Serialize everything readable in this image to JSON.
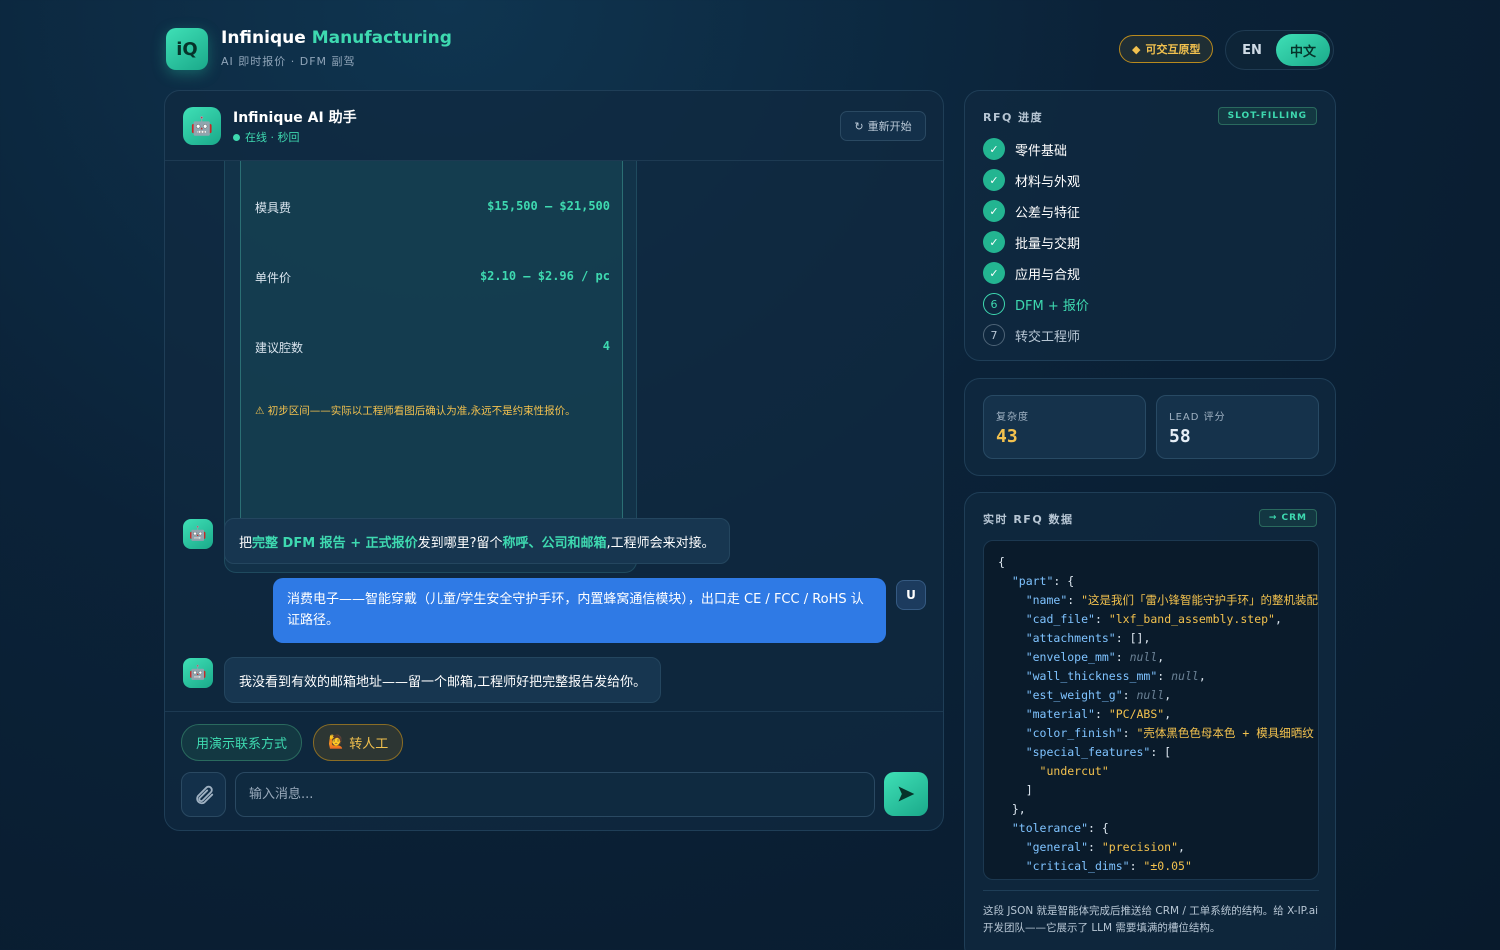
{
  "header": {
    "logo_text": "iQ",
    "brand_name": "Infinique",
    "brand_accent": "Manufacturing",
    "tagline": "AI 即时报价 · DFM 副驾",
    "prototype_badge": "可交互原型",
    "lang_en": "EN",
    "lang_zh": "中文"
  },
  "chat": {
    "title": "Infinique AI 助手",
    "status": "在线 · 秒回",
    "restart_label": "重新开始",
    "quote_card": {
      "rows": [
        {
          "label": "模具费",
          "value": "$15,500 – $21,500"
        },
        {
          "label": "单件价",
          "value": "$2.10 – $2.96 / pc"
        },
        {
          "label": "建议腔数",
          "value": "4"
        }
      ],
      "note": "⚠ 初步区间——实际以工程师看图后确认为准,永远不是约束性报价。"
    },
    "messages": {
      "bot1_a": "把",
      "bot1_b": "完整 DFM 报告 + 正式报价",
      "bot1_c": "发到哪里?留个",
      "bot1_d": "称呼、公司和邮箱",
      "bot1_e": ",工程师会来对接。",
      "user1": "消费电子——智能穿戴（儿童/学生安全守护手环，内置蜂窝通信模块），出口走 CE / FCC / RoHS 认证路径。",
      "user_avatar": "U",
      "bot2": "我没看到有效的邮箱地址——留一个邮箱,工程师好把完整报告发给你。"
    },
    "quick_replies": {
      "demo_contact": "用演示联系方式",
      "human": "转人工"
    },
    "input_placeholder": "输入消息..."
  },
  "rfq_progress": {
    "title": "RFQ 进度",
    "tag": "SLOT-FILLING",
    "steps": [
      {
        "num": "1",
        "label": "零件基础",
        "state": "done"
      },
      {
        "num": "2",
        "label": "材料与外观",
        "state": "done"
      },
      {
        "num": "3",
        "label": "公差与特征",
        "state": "done"
      },
      {
        "num": "4",
        "label": "批量与交期",
        "state": "done"
      },
      {
        "num": "5",
        "label": "应用与合规",
        "state": "done"
      },
      {
        "num": "6",
        "label": "DFM + 报价",
        "state": "active"
      },
      {
        "num": "7",
        "label": "转交工程师",
        "state": "todo"
      }
    ]
  },
  "metrics": {
    "complexity_label": "复杂度",
    "complexity_value": "43",
    "lead_label": "LEAD 评分",
    "lead_value": "58",
    "complexity_color": "#f2c14e",
    "lead_color": "#e6eef6"
  },
  "rfq_data": {
    "title": "实时 RFQ 数据",
    "tag": "→ CRM",
    "json_lines": {
      "l1": "{",
      "l2_k": "\"part\"",
      "l3_k": "\"name\"",
      "l3_v": "\"这是我们「雷小锋智能守护手环」的整机装配",
      "l4_k": "\"cad_file\"",
      "l4_v": "\"lxf_band_assembly.step\"",
      "l5_k": "\"attachments\"",
      "l5_v": "[]",
      "l6_k": "\"envelope_mm\"",
      "l6_v": "null",
      "l7_k": "\"wall_thickness_mm\"",
      "l7_v": "null",
      "l8_k": "\"est_weight_g\"",
      "l8_v": "null",
      "l9_k": "\"material\"",
      "l9_v": "\"PC/ABS\"",
      "l10_k": "\"color_finish\"",
      "l10_v": "\"壳体黑色色母本色 + 模具细晒纹",
      "l11_k": "\"special_features\"",
      "l12_v": "\"undercut\"",
      "l13": "]",
      "l14": "},",
      "l15_k": "\"tolerance\"",
      "l16_k": "\"general\"",
      "l16_v": "\"precision\"",
      "l17_k": "\"critical_dims\"",
      "l17_v": "\"±0.05\""
    },
    "note": "这段 JSON 就是智能体完成后推送给 CRM / 工单系统的结构。给 X-IP.ai 开发团队——它展示了 LLM 需要填满的槽位结构。"
  }
}
